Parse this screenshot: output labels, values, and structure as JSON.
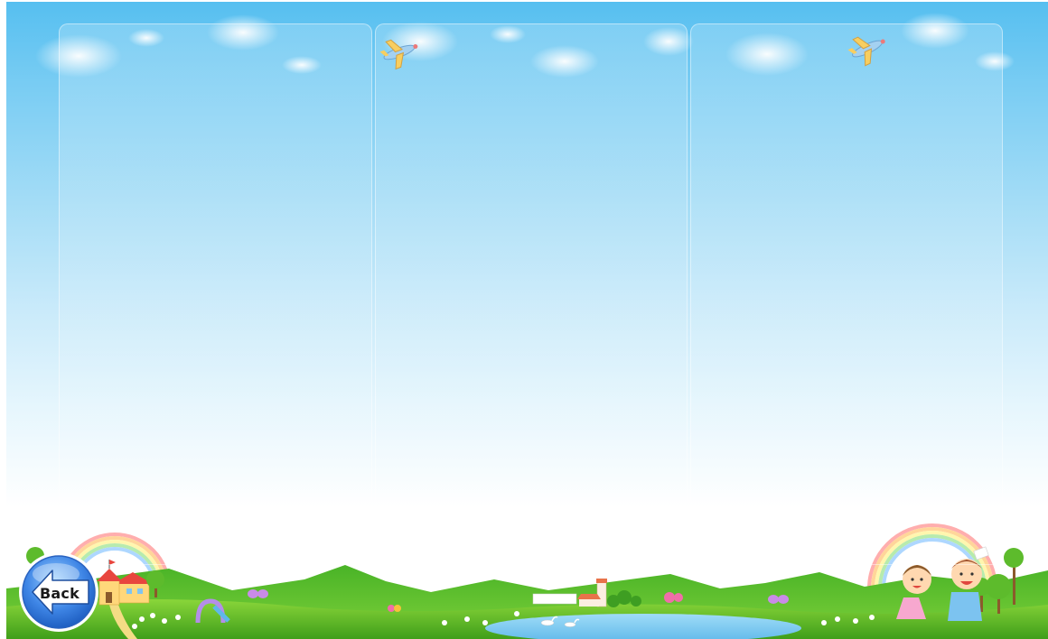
{
  "nav": {
    "back_label": "Back"
  },
  "panels": [
    {
      "id": "panel-left"
    },
    {
      "id": "panel-middle"
    },
    {
      "id": "panel-right"
    }
  ],
  "icons": [
    "arrow-left-icon",
    "airplane-icon",
    "cloud-icon",
    "rainbow-icon",
    "butterfly-icon",
    "school-house-icon",
    "tree-icon",
    "child-girl-icon",
    "child-boy-icon",
    "swan-icon",
    "lighthouse-icon",
    "slide-icon"
  ],
  "colors": {
    "sky_top": "#56bff0",
    "sky_bottom": "#ffffff",
    "grass": "#6cc42a",
    "hills": "#4aa820",
    "pond": "#8fd0f2",
    "button": "#3f86e6"
  }
}
